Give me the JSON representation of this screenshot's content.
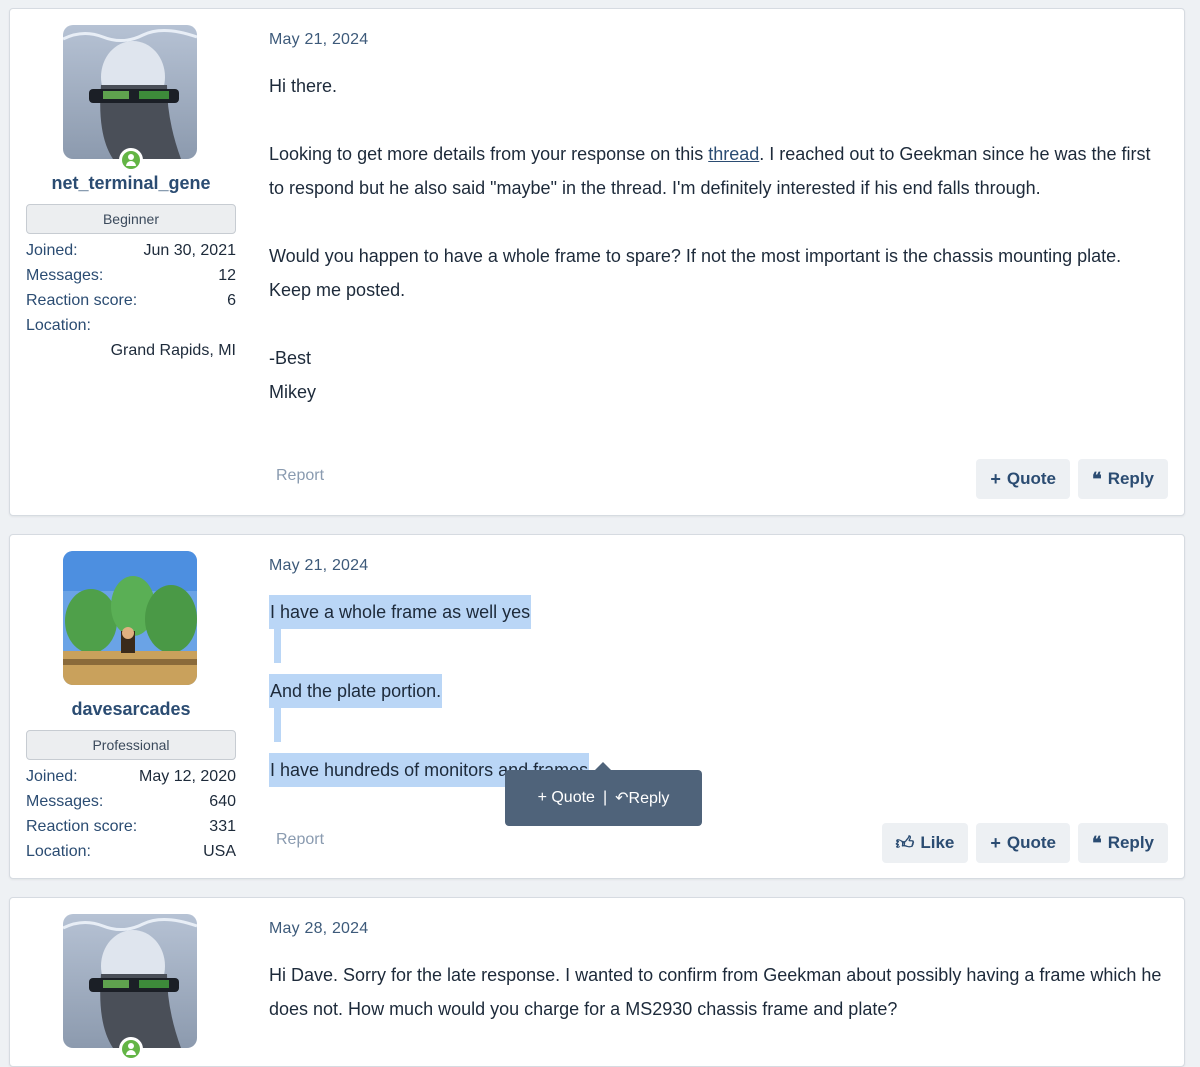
{
  "posts": [
    {
      "user": {
        "name": "net_terminal_gene",
        "rank": "Beginner",
        "joined_label": "Joined:",
        "joined": "Jun 30, 2021",
        "messages_label": "Messages:",
        "messages": "12",
        "reaction_label": "Reaction score:",
        "reaction": "6",
        "location_label": "Location:",
        "location": "Grand Rapids, MI"
      },
      "date": "May 21, 2024",
      "body": {
        "p1": "Hi there.",
        "p2_before": "Looking to get more details from your response on this ",
        "p2_link": "thread",
        "p2_after": ". I reached out to Geekman since he was the first to respond but he also said \"maybe\" in the thread. I'm definitely interested if his end falls through.",
        "p3": "Would you happen to have a whole frame to spare? If not the most important is the chassis mounting plate. Keep me posted.",
        "p4": "-Best",
        "p5": "Mikey"
      },
      "report": "Report",
      "quote": "Quote",
      "reply": "Reply"
    },
    {
      "user": {
        "name": "davesarcades",
        "rank": "Professional",
        "joined_label": "Joined:",
        "joined": "May 12, 2020",
        "messages_label": "Messages:",
        "messages": "640",
        "reaction_label": "Reaction score:",
        "reaction": "331",
        "location_label": "Location:",
        "location": "USA"
      },
      "date": "May 21, 2024",
      "body": {
        "l1": "I have a whole frame as well yes",
        "l2": "And the plate portion.",
        "l3": "I have hundreds of monitors and frames"
      },
      "report": "Report",
      "like": "Like",
      "quote": "Quote",
      "reply": "Reply"
    },
    {
      "date": "May 28, 2024",
      "body": "Hi Dave. Sorry for the late response. I wanted to confirm from Geekman about possibly having a frame which he does not. How much would you charge for a MS2930 chassis frame and plate?"
    }
  ],
  "selection_tooltip": {
    "quote": "Quote",
    "separator": "|",
    "reply": "Reply"
  },
  "colors": {
    "accent": "#2b4c72",
    "selection": "#bad6f6",
    "online": "#63b545"
  }
}
